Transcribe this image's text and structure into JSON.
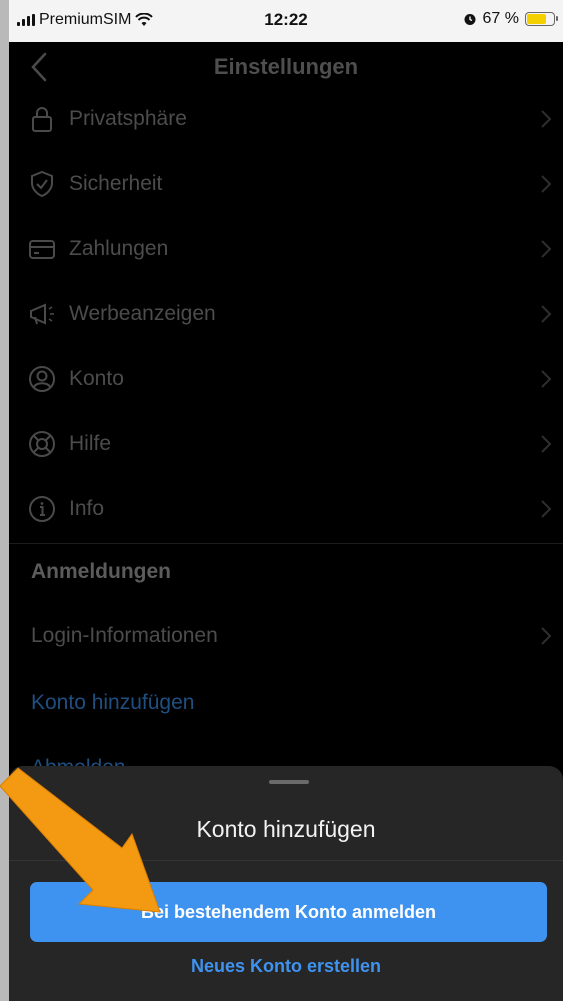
{
  "status_bar": {
    "carrier": "PremiumSIM",
    "time": "12:22",
    "battery_percent": "67 %",
    "battery_level": 0.67
  },
  "header": {
    "title": "Einstellungen",
    "back_icon": "chevron-left-icon"
  },
  "menu": {
    "items": [
      {
        "label": "Privatsphäre",
        "icon": "lock-icon"
      },
      {
        "label": "Sicherheit",
        "icon": "shield-check-icon"
      },
      {
        "label": "Zahlungen",
        "icon": "credit-card-icon"
      },
      {
        "label": "Werbeanzeigen",
        "icon": "megaphone-icon"
      },
      {
        "label": "Konto",
        "icon": "account-circle-icon"
      },
      {
        "label": "Hilfe",
        "icon": "lifebuoy-icon"
      },
      {
        "label": "Info",
        "icon": "info-icon"
      }
    ]
  },
  "logins": {
    "section_title": "Anmeldungen",
    "login_info": "Login-Informationen",
    "add_account": "Konto hinzufügen",
    "logout": "Abmelden"
  },
  "sheet": {
    "title": "Konto hinzufügen",
    "primary_button": "Bei bestehendem Konto anmelden",
    "secondary_link": "Neues Konto erstellen"
  },
  "colors": {
    "accent": "#3f93f0",
    "annotation_arrow": "#f39a12"
  }
}
